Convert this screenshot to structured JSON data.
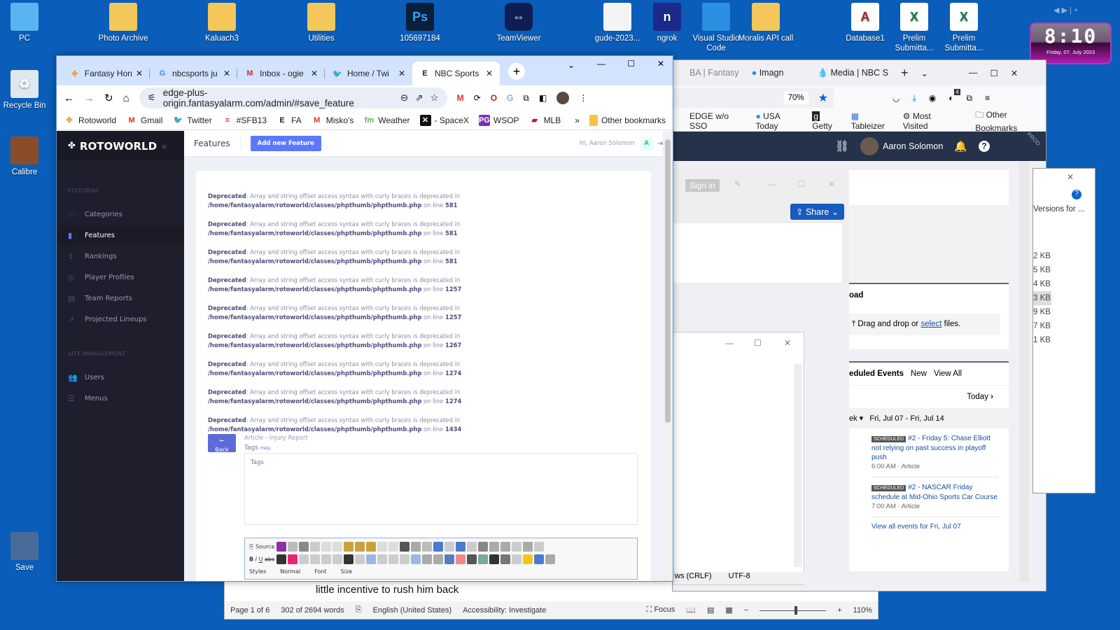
{
  "desktop": {
    "icons_top": [
      {
        "label": "PC",
        "icon": "computer-icon"
      },
      {
        "label": "Photo Archive",
        "icon": "folder-icon"
      },
      {
        "label": "Kaluach3",
        "icon": "calendar-app-icon"
      },
      {
        "label": "Utilities",
        "icon": "folder-icon"
      },
      {
        "label": "105697184",
        "icon": "photoshop-file-icon"
      },
      {
        "label": "TeamViewer",
        "icon": "teamviewer-icon"
      },
      {
        "label": "gude-2023...",
        "icon": "document-icon"
      },
      {
        "label": "ngrok",
        "icon": "ngrok-icon"
      },
      {
        "label": "Visual Studio Code",
        "icon": "vscode-icon"
      },
      {
        "label": "Moralis API call",
        "icon": "folder-icon"
      },
      {
        "label": "Database1",
        "icon": "access-file-icon"
      },
      {
        "label": "Prelim Submitta...",
        "icon": "excel-file-icon"
      },
      {
        "label": "Prelim Submitta...",
        "icon": "excel-file-icon"
      }
    ],
    "icons_left": [
      {
        "label": "Recycle Bin",
        "icon": "recycle-bin-icon"
      },
      {
        "label": "Calibre",
        "icon": "calibre-icon"
      },
      {
        "label": "Save",
        "icon": "video-file-icon"
      }
    ],
    "clock": {
      "time": "8:10",
      "date": "Friday, 07. July 2023"
    }
  },
  "chrome": {
    "tabs": [
      {
        "label": "Fantasy Hon",
        "icon": "nbc-peacock-icon"
      },
      {
        "label": "nbcsports ju",
        "icon": "google-icon"
      },
      {
        "label": "Inbox - ogie",
        "icon": "gmail-icon"
      },
      {
        "label": "Home / Twi",
        "icon": "twitter-icon"
      },
      {
        "label": "NBC Sports",
        "icon": "edge-e-icon",
        "active": true
      }
    ],
    "url": "edge-plus-origin.fantasyalarm.com/admin/#save_feature",
    "bookmarks": [
      {
        "label": "Rotoworld",
        "icon": "nbc-peacock-icon"
      },
      {
        "label": "Gmail",
        "icon": "gmail-icon"
      },
      {
        "label": "Twitter",
        "icon": "twitter-icon"
      },
      {
        "label": "#SFB13",
        "icon": "nfl-icon"
      },
      {
        "label": "FA",
        "icon": "edge-e-icon"
      },
      {
        "label": "Misko's",
        "icon": "misko-icon"
      },
      {
        "label": "Weather",
        "icon": "fm-icon"
      },
      {
        "label": "- SpaceX",
        "icon": "x-icon"
      },
      {
        "label": "WSOP",
        "icon": "pg-icon"
      },
      {
        "label": "MLB",
        "icon": "mlb-icon"
      }
    ],
    "other_bookmarks": "Other bookmarks",
    "more_bookmarks": "»"
  },
  "rotoworld": {
    "logo": "ROTOWORLD",
    "sections": [
      {
        "title": "EDITORIAL",
        "items": [
          {
            "label": "Categories",
            "icon": "folder-open-icon"
          },
          {
            "label": "Features",
            "icon": "file-icon",
            "active": true
          },
          {
            "label": "Rankings",
            "icon": "sort-icon"
          },
          {
            "label": "Player Profiles",
            "icon": "basketball-icon"
          },
          {
            "label": "Team Reports",
            "icon": "clipboard-icon"
          },
          {
            "label": "Projected Lineups",
            "icon": "chart-line-icon"
          }
        ]
      },
      {
        "title": "SITE MANAGEMENT",
        "items": [
          {
            "label": "Users",
            "icon": "users-icon"
          },
          {
            "label": "Menus",
            "icon": "menu-icon"
          }
        ]
      }
    ],
    "header": {
      "title": "Features",
      "add_button": "Add new Feature",
      "greeting": "Hi, Aaron Solomon",
      "avatar_letter": "A"
    },
    "warnings": [
      {
        "label": "Deprecated",
        "message": ": Array and string offset access syntax with curly braces is deprecated in",
        "path": "/home/fantasyalarm/rotoworld/classes/phpthumb/phpthumb.php",
        "on_line": " on line ",
        "line": "581"
      },
      {
        "label": "Deprecated",
        "message": ": Array and string offset access syntax with curly braces is deprecated in",
        "path": "/home/fantasyalarm/rotoworld/classes/phpthumb/phpthumb.php",
        "on_line": " on line ",
        "line": "581"
      },
      {
        "label": "Deprecated",
        "message": ": Array and string offset access syntax with curly braces is deprecated in",
        "path": "/home/fantasyalarm/rotoworld/classes/phpthumb/phpthumb.php",
        "on_line": " on line ",
        "line": "581"
      },
      {
        "label": "Deprecated",
        "message": ": Array and string offset access syntax with curly braces is deprecated in",
        "path": "/home/fantasyalarm/rotoworld/classes/phpthumb/phpthumb.php",
        "on_line": " on line ",
        "line": "1257"
      },
      {
        "label": "Deprecated",
        "message": ": Array and string offset access syntax with curly braces is deprecated in",
        "path": "/home/fantasyalarm/rotoworld/classes/phpthumb/phpthumb.php",
        "on_line": " on line ",
        "line": "1257"
      },
      {
        "label": "Deprecated",
        "message": ": Array and string offset access syntax with curly braces is deprecated in",
        "path": "/home/fantasyalarm/rotoworld/classes/phpthumb/phpthumb.php",
        "on_line": " on line ",
        "line": "1267"
      },
      {
        "label": "Deprecated",
        "message": ": Array and string offset access syntax with curly braces is deprecated in",
        "path": "/home/fantasyalarm/rotoworld/classes/phpthumb/phpthumb.php",
        "on_line": " on line ",
        "line": "1274"
      },
      {
        "label": "Deprecated",
        "message": ": Array and string offset access syntax with curly braces is deprecated in",
        "path": "/home/fantasyalarm/rotoworld/classes/phpthumb/phpthumb.php",
        "on_line": " on line ",
        "line": "1274"
      },
      {
        "label": "Deprecated",
        "message": ": Array and string offset access syntax with curly braces is deprecated in",
        "path": "/home/fantasyalarm/rotoworld/classes/phpthumb/phpthumb.php",
        "on_line": " on line ",
        "line": "1434"
      }
    ],
    "back_button": "Back",
    "article_type": "Article - Injury Report",
    "tags_label": "Tags",
    "tags_help": "Help",
    "tags_placeholder": "Tags",
    "editor": {
      "source_label": "Source",
      "styles_label": "Styles",
      "format_label": "Normal",
      "font_label": "Font",
      "size_label": "Size"
    }
  },
  "firefox": {
    "tabs": [
      "BA | Fantasy",
      "Imagn",
      "Media | NBC S"
    ],
    "zoom": "70%",
    "notification_count": "4",
    "bookmarks": [
      "EDGE w/o SSO",
      "USA Today",
      "Getty",
      "Tableizer",
      "Most Visited"
    ],
    "other_bookmarks": "Other Bookmarks",
    "user_name": "Aaron Solomon",
    "env_badge": "PROD",
    "upload": {
      "title_partial": "oad",
      "drop_text": "Drag and drop or ",
      "select_link": "select",
      "drop_suffix": " files."
    },
    "scheduled": {
      "title_partial": "eduled Events",
      "new_label": "New",
      "view_all_label": "View All",
      "today_label": "Today",
      "range_prefix": "ek",
      "range": "Fri, Jul 07 - Fri, Jul 14",
      "events": [
        {
          "badge": "SCHEDULED",
          "title": "#2 - Friday 5: Chase Elliott not relying on past success in playoff push",
          "time": "6:00 AM",
          "type": "Article"
        },
        {
          "badge": "SCHEDULED",
          "title": "#2 - NASCAR Friday schedule at Mid-Ohio Sports Car Course",
          "time": "7:00 AM",
          "type": "Article"
        }
      ],
      "view_all_events": "View all events for Fri, Jul 07"
    }
  },
  "office_popup": {
    "sign_in": "Sign in",
    "share": "Share"
  },
  "notepad": {
    "line_ending": "ws (CRLF)",
    "encoding": "UTF-8"
  },
  "explorer": {
    "versions_label": "Versions for ...",
    "sizes": [
      "2 KB",
      "5 KB",
      "4 KB",
      "3 KB",
      "9 KB",
      "7 KB",
      "1 KB"
    ]
  },
  "word": {
    "body_text": "little incentive to rush him back",
    "page": "Page 1 of 6",
    "words": "302 of 2694 words",
    "language": "English (United States)",
    "accessibility": "Accessibility: Investigate",
    "focus": "Focus",
    "zoom": "110%",
    "zoom_fraction": 0.55
  }
}
